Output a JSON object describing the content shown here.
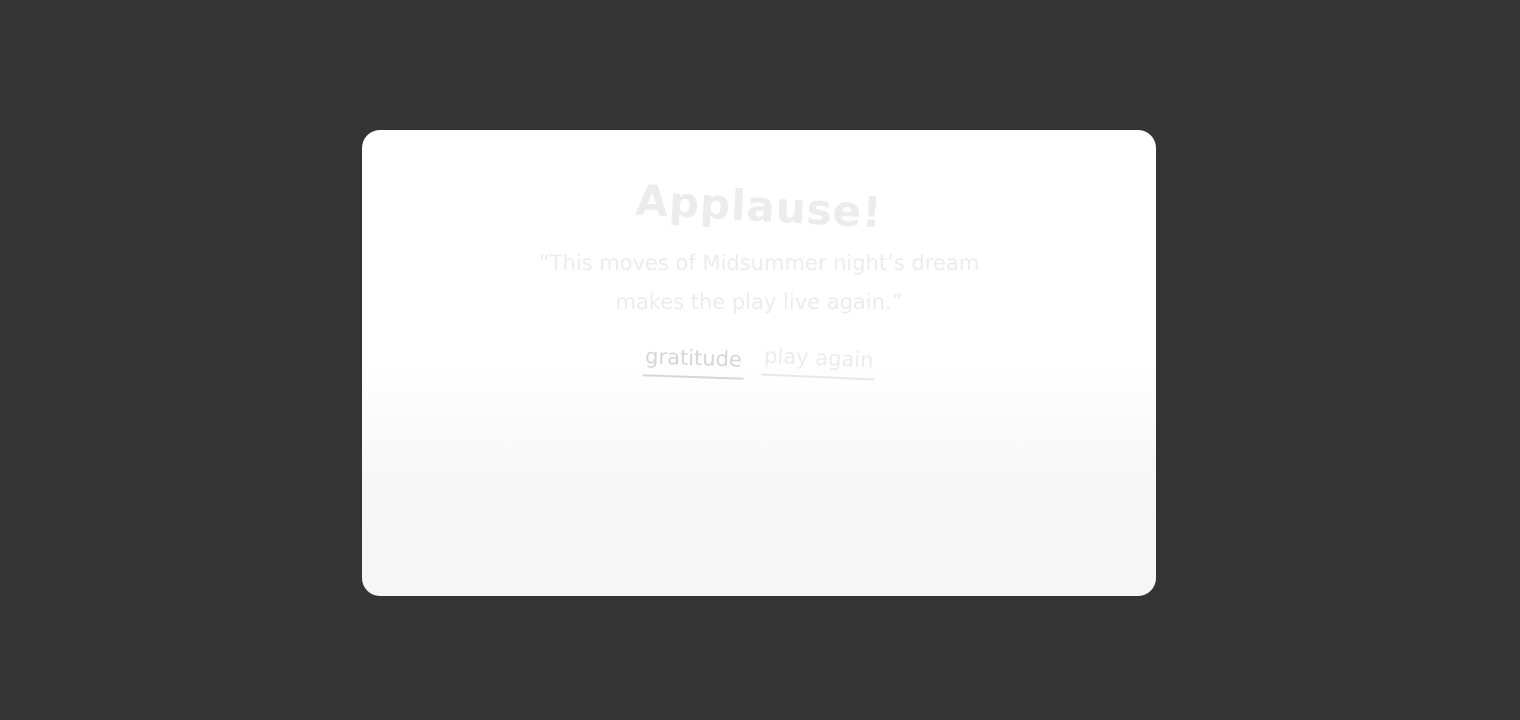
{
  "modal": {
    "title": "Applause!",
    "quote_line1": "“This moves of Midsummer night’s dream",
    "quote_line2": "makes the play live again.”",
    "gratitude_label": "gratitude",
    "play_again_label": "play again"
  },
  "colors": {
    "backdrop": "#343434",
    "card": "#ffffff",
    "faded_text": "#ececec",
    "link_underline": "#d6d6d6"
  }
}
